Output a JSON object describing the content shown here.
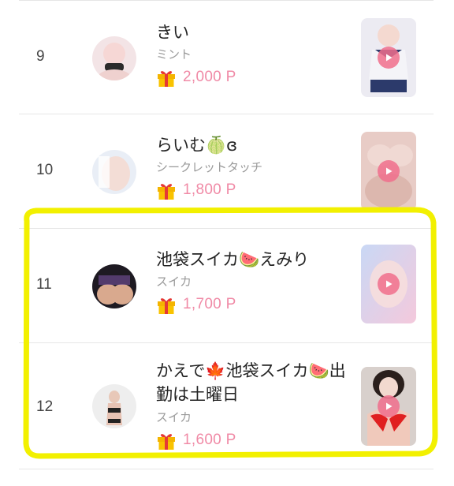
{
  "rows": [
    {
      "rank": "9",
      "name": "きい",
      "shop": "ミント",
      "points": "2,000 P",
      "avatar_icon": "user-avatar-icon",
      "thumb_icon": "video-thumbnail-icon"
    },
    {
      "rank": "10",
      "name": "らいむ🍈ɞ",
      "shop": "シークレットタッチ",
      "points": "1,800 P",
      "avatar_icon": "user-avatar-icon",
      "thumb_icon": "video-thumbnail-icon"
    },
    {
      "rank": "11",
      "name": "池袋スイカ🍉えみり",
      "shop": "スイカ",
      "points": "1,700 P",
      "avatar_icon": "user-avatar-icon",
      "thumb_icon": "video-thumbnail-icon"
    },
    {
      "rank": "12",
      "name": "かえで🍁池袋スイカ🍉出勤は土曜日",
      "shop": "スイカ",
      "points": "1,600 P",
      "avatar_icon": "user-avatar-icon",
      "thumb_icon": "video-thumbnail-icon"
    }
  ],
  "colors": {
    "points": "#f08aa6",
    "highlight": "#f2f000",
    "play_button": "#f06e8c",
    "divider": "#e6e6e6"
  },
  "icons": {
    "gift": "gift-icon",
    "play": "play-icon",
    "highlight": "yellow-highlight-annotation"
  }
}
